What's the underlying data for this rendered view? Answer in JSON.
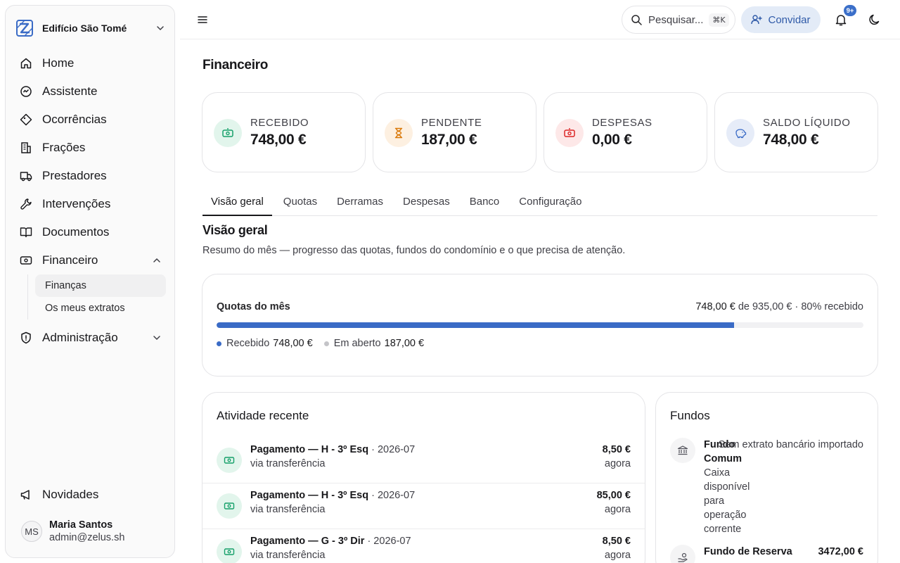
{
  "app": {
    "org_name": "Edifício São Tomé"
  },
  "sidebar": {
    "items": [
      {
        "label": "Home",
        "icon": "home-icon"
      },
      {
        "label": "Assistente",
        "icon": "assistant-icon"
      },
      {
        "label": "Ocorrências",
        "icon": "tag-icon"
      },
      {
        "label": "Frações",
        "icon": "building-icon"
      },
      {
        "label": "Prestadores",
        "icon": "truck-icon"
      },
      {
        "label": "Intervenções",
        "icon": "wrench-icon"
      },
      {
        "label": "Documentos",
        "icon": "book-icon"
      },
      {
        "label": "Financeiro",
        "icon": "banknote-icon"
      },
      {
        "label": "Administração",
        "icon": "shield-icon"
      }
    ],
    "financeiro_sub": [
      "Finanças",
      "Os meus extratos"
    ],
    "novidades": "Novidades",
    "user": {
      "initials": "MS",
      "name": "Maria Santos",
      "email": "admin@zelus.sh"
    }
  },
  "header": {
    "search_placeholder": "Pesquisar...",
    "search_shortcut": "⌘K",
    "invite_label": "Convidar",
    "notifications_badge": "9+"
  },
  "page": {
    "title": "Financeiro"
  },
  "stats": [
    {
      "label": "RECEBIDO",
      "value": "748,00 €",
      "icon": "banknote-icon",
      "bg": "#e2f5ec",
      "fg": "#16a06a"
    },
    {
      "label": "PENDENTE",
      "value": "187,00 €",
      "icon": "hourglass-icon",
      "bg": "#fdf0e1",
      "fg": "#d97706"
    },
    {
      "label": "DESPESAS",
      "value": "0,00 €",
      "icon": "banknote-icon",
      "bg": "#fde8e8",
      "fg": "#dc2626"
    },
    {
      "label": "SALDO LÍQUIDO",
      "value": "748,00 €",
      "icon": "piggy-bank-icon",
      "bg": "#e6ecf8",
      "fg": "#3a6bc6"
    }
  ],
  "tabs": [
    "Visão geral",
    "Quotas",
    "Derramas",
    "Despesas",
    "Banco",
    "Configuração"
  ],
  "overview": {
    "title": "Visão geral",
    "description": "Resumo do mês — progresso das quotas, fundos do condomínio e o que precisa de atenção."
  },
  "quotas": {
    "title": "Quotas do mês",
    "received": "748,00 €",
    "of_text": "de",
    "total": "935,00 €",
    "percent_text": "· 80% recebido",
    "progress": 0.8,
    "legend_received_label": "Recebido",
    "legend_received_value": "748,00 €",
    "legend_open_label": "Em aberto",
    "legend_open_value": "187,00 €",
    "color_received": "#3a6bc6",
    "color_open": "#c4c4c8"
  },
  "activity": {
    "title": "Atividade recente",
    "rows": [
      {
        "title": "Pagamento — H - 3º Esq",
        "period": "· 2026-07",
        "sub": "via transferência",
        "amount": "8,50 €",
        "time": "agora"
      },
      {
        "title": "Pagamento — H - 3º Esq",
        "period": "· 2026-07",
        "sub": "via transferência",
        "amount": "85,00 €",
        "time": "agora"
      },
      {
        "title": "Pagamento — G - 3º Dir",
        "period": "· 2026-07",
        "sub": "via transferência",
        "amount": "8,50 €",
        "time": "agora"
      }
    ]
  },
  "funds": {
    "title": "Fundos",
    "items": [
      {
        "name": "Fundo Comum",
        "description": "Caixa disponível para operação corrente",
        "note": "Sem extrato bancário importado",
        "amount": "",
        "icon": "bank-icon"
      },
      {
        "name": "Fundo de Reserva",
        "description": "",
        "note": "",
        "amount": "3472,00 €",
        "icon": "hand-coins-icon"
      }
    ]
  }
}
